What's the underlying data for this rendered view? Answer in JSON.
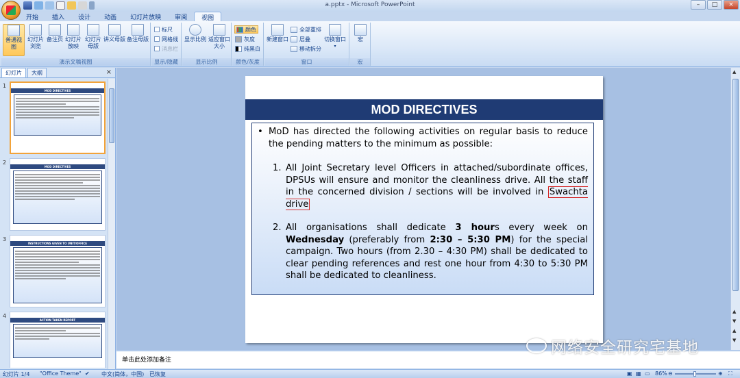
{
  "window": {
    "title": "a.pptx - Microsoft PowerPoint",
    "controls": {
      "minimize": "–",
      "maximize": "□",
      "close": "×"
    }
  },
  "ribbon": {
    "tabs": [
      "开始",
      "插入",
      "设计",
      "动画",
      "幻灯片放映",
      "审阅",
      "视图"
    ],
    "active_tab": "视图",
    "groups": {
      "presentation_views": {
        "label": "演示文稿视图",
        "buttons": [
          "普通视图",
          "幻灯片浏览",
          "备注页",
          "幻灯片放映",
          "幻灯片母版",
          "讲义母版",
          "备注母版"
        ]
      },
      "show_hide": {
        "label": "显示/隐藏",
        "items": [
          "标尺",
          "网格线",
          "消息栏"
        ]
      },
      "zoom": {
        "label": "显示比例",
        "buttons": [
          "显示比例",
          "适应窗口大小"
        ]
      },
      "color": {
        "label": "颜色/灰度",
        "items": [
          "颜色",
          "灰度",
          "纯黑白"
        ]
      },
      "window": {
        "label": "窗口",
        "new_window": "新建窗口",
        "items": [
          "全部重排",
          "层叠",
          "移动拆分"
        ],
        "switch": "切换窗口"
      },
      "macro": {
        "label": "宏",
        "button": "宏"
      }
    }
  },
  "left_pane": {
    "tabs": [
      "幻灯片",
      "大纲"
    ],
    "close": "×",
    "thumbnails": [
      {
        "num": "1",
        "title": "MOD DIRECTIVES"
      },
      {
        "num": "2",
        "title": "MOD DIRECTIVES"
      },
      {
        "num": "3",
        "title": "INSTRUCTIONS GIVEN TO UNIT/OFFICE"
      },
      {
        "num": "4",
        "title": "ACTION TAKEN REPORT"
      }
    ]
  },
  "slide": {
    "title": "MOD DIRECTIVES",
    "bullet": "MoD has directed the following activities on regular basis to reduce the pending matters to the minimum as possible:",
    "items": [
      {
        "num": "1.",
        "text_before": "All Joint Secretary level  Officers in attached/subordinate offices, DPSUs will ensure and monitor the cleanliness drive. All the staff in the concerned division / sections will be involved in ",
        "highlight": "Swachta drive"
      },
      {
        "num": "2.",
        "p1": "All organisations shall dedicate ",
        "b1": "3 hour",
        "p2": "s every week on ",
        "b2": "Wednesday",
        "p3": " (preferably  from ",
        "b3": "2:30 – 5:30 PM",
        "p4": ") for the special campaign. Two hours (from 2.30 – 4:30 PM) shall be dedicated to clear pending references and rest one hour from 4:30 to 5:30 PM shall be dedicated to cleanliness."
      }
    ]
  },
  "notes": {
    "placeholder": "单击此处添加备注"
  },
  "watermark": "网络安全研究宅基地",
  "status": {
    "slide_count": "幻灯片 1/4",
    "theme": "\"Office Theme\"",
    "language": "中文(简体，中国)",
    "recovered": "已恢复",
    "zoom": "86%"
  }
}
